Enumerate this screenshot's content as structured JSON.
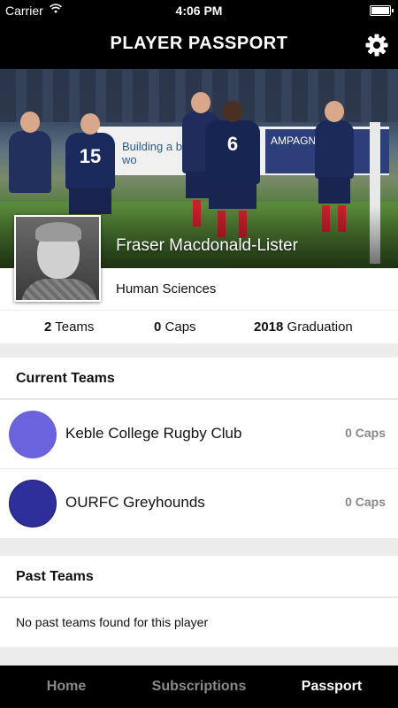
{
  "status_bar": {
    "carrier": "Carrier",
    "time": "4:06 PM"
  },
  "header": {
    "title": "PLAYER PASSPORT",
    "settings_icon": "gear-icon"
  },
  "hero": {
    "banner_text": "Building a b working wo",
    "banner_right_text": "AMPAGN"
  },
  "player": {
    "name": "Fraser Macdonald-Lister",
    "college": "Human Sciences"
  },
  "stats": {
    "teams_value": "2",
    "teams_label": "Teams",
    "caps_value": "0",
    "caps_label": "Caps",
    "graduation_value": "2018",
    "graduation_label": "Graduation"
  },
  "current_teams": {
    "heading": "Current Teams",
    "items": [
      {
        "name": "Keble College Rugby Club",
        "caps": "0 Caps",
        "color": "#6b62dd"
      },
      {
        "name": "OURFC Greyhounds",
        "caps": "0 Caps",
        "color": "#2e2f9a"
      }
    ]
  },
  "past_teams": {
    "heading": "Past Teams",
    "empty_message": "No past teams found for this player"
  },
  "tabs": [
    {
      "label": "Home",
      "active": false
    },
    {
      "label": "Subscriptions",
      "active": false
    },
    {
      "label": "Passport",
      "active": true
    }
  ]
}
